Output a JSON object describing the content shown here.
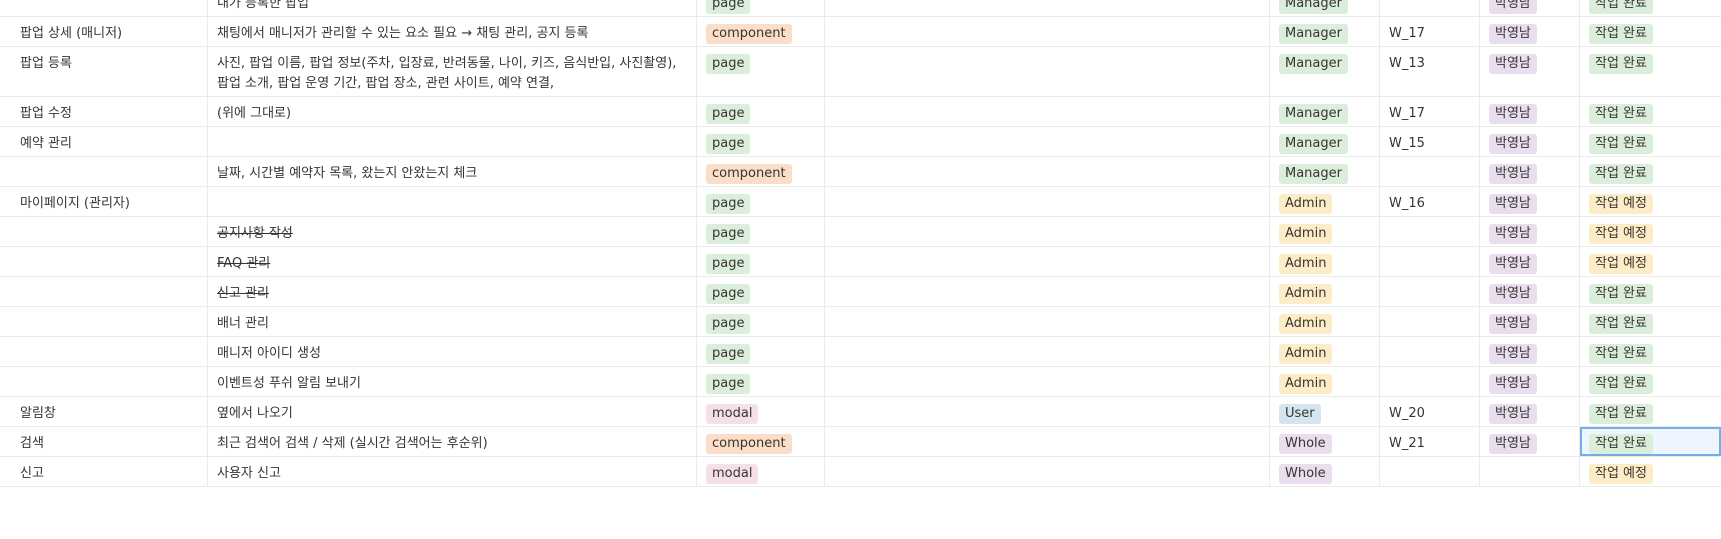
{
  "colors": {
    "page": "#dbeddb",
    "component": "#fadec9",
    "modal": "#f5e0e9",
    "manager": "#dbeddb",
    "admin": "#fdecc8",
    "user": "#d3e5ef",
    "whole": "#e8deee",
    "owner": "#e8deee",
    "done": "#dbeddb",
    "planned": "#fdecc8"
  },
  "rows": [
    {
      "name": "",
      "desc": "내가 등록한 팝업",
      "type": "page",
      "note": "",
      "role": "Manager",
      "week": "",
      "owner": "박영남",
      "status": "작업 완료"
    },
    {
      "name": "팝업 상세 (매니저)",
      "desc": "채팅에서 매니저가 관리할 수 있는 요소 필요 → 채팅 관리, 공지 등록",
      "type": "component",
      "note": "",
      "role": "Manager",
      "week": "W_17",
      "owner": "박영남",
      "status": "작업 완료"
    },
    {
      "name": "팝업 등록",
      "desc": "사진, 팝업 이름, 팝업 정보(주차, 입장료, 반려동물, 나이, 키즈, 음식반입, 사진촬영), 팝업 소개, 팝업 운영 기간, 팝업 장소, 관련 사이트, 예약 연결,",
      "type": "page",
      "note": "",
      "role": "Manager",
      "week": "W_13",
      "owner": "박영남",
      "status": "작업 완료"
    },
    {
      "name": "팝업 수정",
      "desc": "(위에 그대로)",
      "type": "page",
      "note": "",
      "role": "Manager",
      "week": "W_17",
      "owner": "박영남",
      "status": "작업 완료"
    },
    {
      "name": "예약 관리",
      "desc": "",
      "type": "page",
      "note": "",
      "role": "Manager",
      "week": "W_15",
      "owner": "박영남",
      "status": "작업 완료"
    },
    {
      "name": "",
      "desc": "날짜, 시간별 예약자 목록, 왔는지 안왔는지 체크",
      "type": "component",
      "note": "",
      "role": "Manager",
      "week": "",
      "owner": "박영남",
      "status": "작업 완료"
    },
    {
      "name": "마이페이지 (관리자)",
      "desc": "",
      "type": "page",
      "note": "",
      "role": "Admin",
      "week": "W_16",
      "owner": "박영남",
      "status": "작업 예정"
    },
    {
      "name": "",
      "desc": "공지사항 작성",
      "type": "page",
      "note": "",
      "role": "Admin",
      "week": "",
      "owner": "박영남",
      "status": "작업 예정"
    },
    {
      "name": "",
      "desc": "FAQ 관리",
      "type": "page",
      "note": "",
      "role": "Admin",
      "week": "",
      "owner": "박영남",
      "status": "작업 예정"
    },
    {
      "name": "",
      "desc": "신고 관리",
      "type": "page",
      "note": "",
      "role": "Admin",
      "week": "",
      "owner": "박영남",
      "status": "작업 완료"
    },
    {
      "name": "",
      "desc": "배너 관리",
      "type": "page",
      "note": "",
      "role": "Admin",
      "week": "",
      "owner": "박영남",
      "status": "작업 완료"
    },
    {
      "name": "",
      "desc": "매니저 아이디 생성",
      "type": "page",
      "note": "",
      "role": "Admin",
      "week": "",
      "owner": "박영남",
      "status": "작업 완료"
    },
    {
      "name": "",
      "desc": "이벤트성 푸쉬 알림 보내기",
      "type": "page",
      "note": "",
      "role": "Admin",
      "week": "",
      "owner": "박영남",
      "status": "작업 완료"
    },
    {
      "name": "알림창",
      "desc": "옆에서 나오기",
      "type": "modal",
      "note": "",
      "role": "User",
      "week": "W_20",
      "owner": "박영남",
      "status": "작업 완료"
    },
    {
      "name": "검색",
      "desc": "최근 검색어 검색 / 삭제 (실시간 검색어는 후순위)",
      "type": "component",
      "note": "",
      "role": "Whole",
      "week": "W_21",
      "owner": "박영남",
      "status": "작업 완료"
    },
    {
      "name": "신고",
      "desc": "사용자 신고",
      "type": "modal",
      "note": "",
      "role": "Whole",
      "week": "",
      "owner": "",
      "status": "작업 예정"
    }
  ]
}
